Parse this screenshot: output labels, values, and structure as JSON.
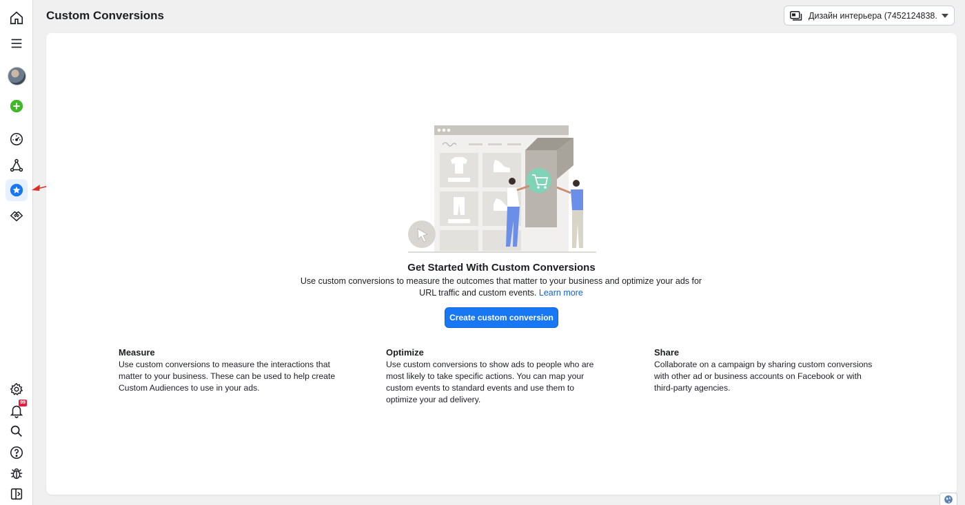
{
  "header": {
    "title": "Custom Conversions",
    "account_selector": "Дизайн интерьера (7452124838..."
  },
  "sidebar": {
    "items": [
      {
        "name": "home",
        "icon": "home-icon"
      },
      {
        "name": "menu",
        "icon": "hamburger-menu-icon"
      },
      {
        "name": "profile",
        "icon": "avatar"
      },
      {
        "name": "create",
        "icon": "plus-circle-icon"
      },
      {
        "name": "dashboard",
        "icon": "gauge-icon"
      },
      {
        "name": "events",
        "icon": "network-nodes-icon"
      },
      {
        "name": "custom-conversions",
        "icon": "star-circle-icon",
        "active": true
      },
      {
        "name": "partners",
        "icon": "handshake-icon"
      },
      {
        "name": "settings",
        "icon": "gear-icon"
      },
      {
        "name": "notifications",
        "icon": "bell-icon",
        "badge": "99"
      },
      {
        "name": "search",
        "icon": "search-icon"
      },
      {
        "name": "help",
        "icon": "question-icon"
      },
      {
        "name": "report-bug",
        "icon": "bug-icon"
      },
      {
        "name": "toggle-panel",
        "icon": "sidebar-toggle-icon"
      }
    ]
  },
  "main": {
    "heading": "Get Started With Custom Conversions",
    "description": "Use custom conversions to measure the outcomes that matter to your business and optimize your ads for URL traffic and custom events.",
    "learn_more": "Learn more",
    "cta_label": "Create custom conversion",
    "features": [
      {
        "title": "Measure",
        "text": "Use custom conversions to measure the interactions that matter to your business. These can be used to help create Custom Audiences to use in your ads."
      },
      {
        "title": "Optimize",
        "text": "Use custom conversions to show ads to people who are most likely to take specific actions. You can map your custom events to standard events and use them to optimize your ad delivery."
      },
      {
        "title": "Share",
        "text": "Collaborate on a campaign by sharing custom conversions with other ad or business accounts on Facebook or with third-party agencies."
      }
    ]
  },
  "colors": {
    "accent": "#1877f2",
    "link": "#1660c9",
    "create_green": "#42b72a",
    "annotation_arrow": "#d93025"
  }
}
